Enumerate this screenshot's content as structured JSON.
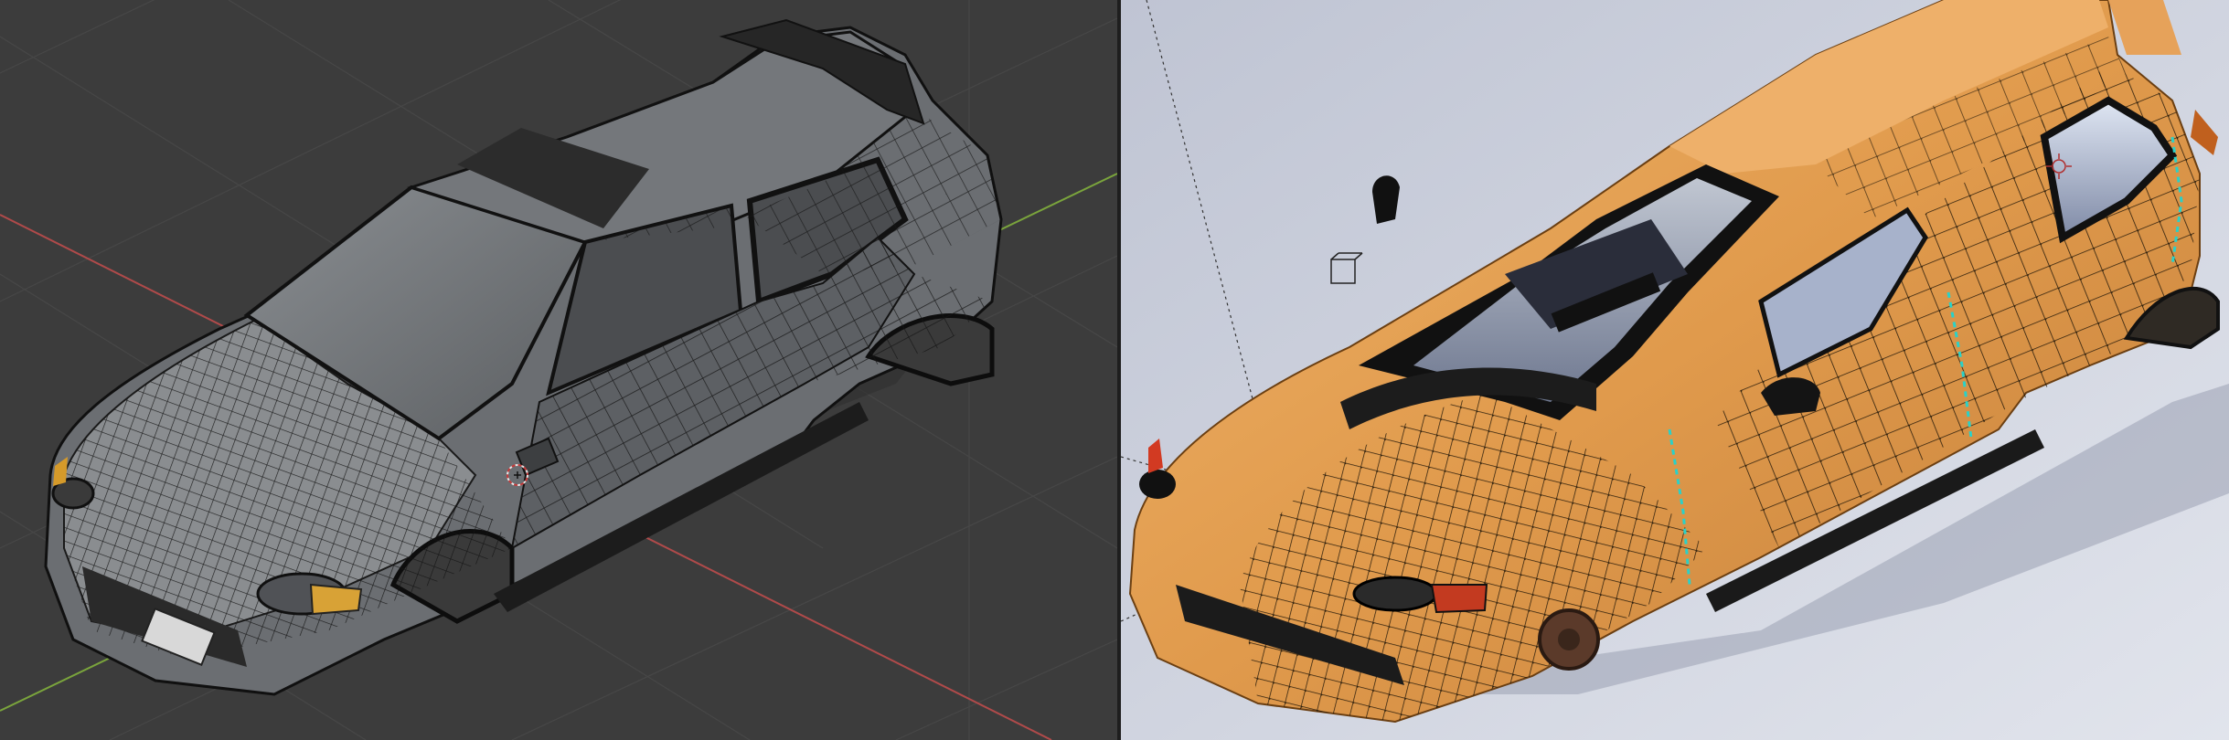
{
  "app": {
    "window_title": ""
  },
  "viewports": {
    "left": {
      "mode": "",
      "shading": "solid wireframe",
      "background_color": "#3c3c3c",
      "grid_color": "#4a4a4a",
      "x_axis_color": "#b04a4a",
      "y_axis_color": "#7aa43c",
      "car_body_color": "#6b6e72",
      "wire_color": "#111111",
      "icons": [
        "3d-cursor-icon"
      ]
    },
    "right": {
      "mode": "",
      "shading": "rendered",
      "background_color": "#c9cfdc",
      "car_body_color": "#e2a058",
      "wire_color": "#1a1206",
      "seam_color": "#2ad1c8",
      "icons": [
        "light-origin-icon",
        "camera-empty-icon"
      ]
    }
  }
}
